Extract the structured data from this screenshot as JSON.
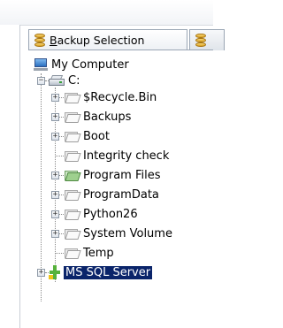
{
  "tabs": [
    {
      "label_prefix": "",
      "label_ul": "B",
      "label_rest": "ackup Selection",
      "active": true
    },
    {
      "label_prefix": "",
      "label_ul": "",
      "label_rest": "",
      "active": false
    }
  ],
  "tree": {
    "root": {
      "label": "My Computer",
      "icon": "computer-icon"
    },
    "drive": {
      "label": "C:",
      "icon": "drive-icon"
    },
    "folders": [
      {
        "label": "$Recycle.Bin",
        "expandable": true,
        "icon": "folder-icon"
      },
      {
        "label": "Backups",
        "expandable": true,
        "icon": "folder-icon"
      },
      {
        "label": "Boot",
        "expandable": true,
        "icon": "folder-icon"
      },
      {
        "label": "Integrity check",
        "expandable": false,
        "icon": "folder-icon"
      },
      {
        "label": "Program Files",
        "expandable": true,
        "icon": "folder-green-icon"
      },
      {
        "label": "ProgramData",
        "expandable": true,
        "icon": "folder-icon"
      },
      {
        "label": "Python26",
        "expandable": true,
        "icon": "folder-icon"
      },
      {
        "label": "System Volume",
        "expandable": true,
        "icon": "folder-icon"
      },
      {
        "label": "Temp",
        "expandable": false,
        "icon": "folder-icon"
      }
    ],
    "sql": {
      "label": "MS SQL Server",
      "icon": "sql-server-icon",
      "selected": true
    }
  },
  "colors": {
    "selection": "#0a246a",
    "selection_text": "#ffffff",
    "tab_border": "#9aa6b4"
  }
}
